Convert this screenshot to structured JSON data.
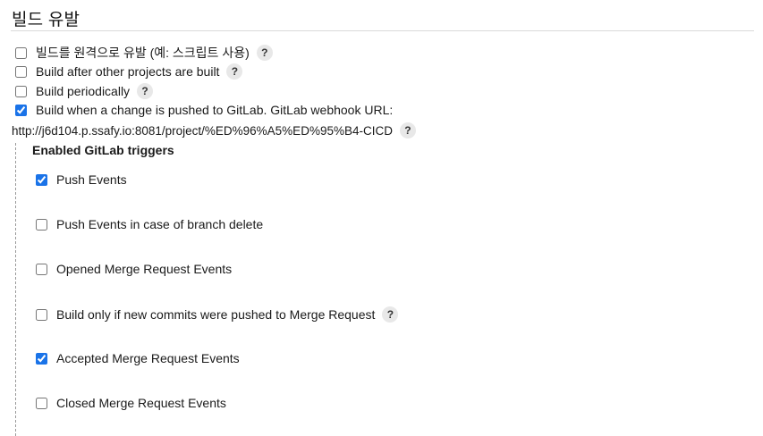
{
  "section": {
    "title": "빌드 유발"
  },
  "build_triggers": [
    {
      "label": "빌드를 원격으로 유발 (예: 스크립트 사용)",
      "checked": false,
      "has_help": true
    },
    {
      "label": "Build after other projects are built",
      "checked": false,
      "has_help": true
    },
    {
      "label": "Build periodically",
      "checked": false,
      "has_help": true
    },
    {
      "label": "Build when a change is pushed to GitLab. GitLab webhook URL:",
      "checked": true,
      "has_help": false
    }
  ],
  "webhook": {
    "url": "http://j6d104.p.ssafy.io:8081/project/%ED%96%A5%ED%95%B4-CICD",
    "help_glyph": "?"
  },
  "gitlab_triggers": {
    "title": "Enabled GitLab triggers",
    "items": [
      {
        "label": "Push Events",
        "checked": true,
        "has_help": false
      },
      {
        "label": "Push Events in case of branch delete",
        "checked": false,
        "has_help": false
      },
      {
        "label": "Opened Merge Request Events",
        "checked": false,
        "has_help": false
      },
      {
        "label": "Build only if new commits were pushed to Merge Request",
        "checked": false,
        "has_help": true
      },
      {
        "label": "Accepted Merge Request Events",
        "checked": true,
        "has_help": false
      },
      {
        "label": "Closed Merge Request Events",
        "checked": false,
        "has_help": false
      }
    ]
  },
  "help_glyph": "?",
  "colors": {
    "accent": "#1a73e8",
    "help_bg": "#e8e8e8",
    "rule": "#d9d9d9",
    "dashed_guide": "#9a9a9a"
  }
}
